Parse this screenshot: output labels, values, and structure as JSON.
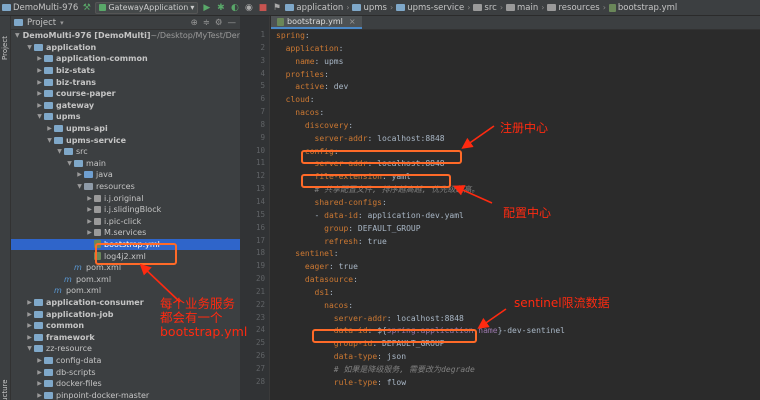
{
  "navbar": {
    "crumbs": [
      "DemoMulti-976",
      "application",
      "upms",
      "upms-service",
      "src",
      "main",
      "resources",
      "bootstrap.yml"
    ],
    "run_config": "GatewayApplication"
  },
  "side_tabs": {
    "project": "Project",
    "structure": "Structure"
  },
  "project_panel": {
    "title": "Project",
    "tree": [
      {
        "text": "DemoMulti-976 [DemoMulti]",
        "extra": " ~/Desktop/MyTest/Der",
        "indent": 0,
        "arrow": "down",
        "icon": "folder",
        "bold": true
      },
      {
        "text": "application",
        "indent": 1,
        "arrow": "down",
        "icon": "folder",
        "bold": true
      },
      {
        "text": "application-common",
        "indent": 2,
        "arrow": "right",
        "icon": "folder",
        "bold": true
      },
      {
        "text": "biz-stats",
        "indent": 2,
        "arrow": "right",
        "icon": "folder",
        "bold": true
      },
      {
        "text": "biz-trans",
        "indent": 2,
        "arrow": "right",
        "icon": "folder",
        "bold": true
      },
      {
        "text": "course-paper",
        "indent": 2,
        "arrow": "right",
        "icon": "folder",
        "bold": true
      },
      {
        "text": "gateway",
        "indent": 2,
        "arrow": "right",
        "icon": "folder",
        "bold": true
      },
      {
        "text": "upms",
        "indent": 2,
        "arrow": "down",
        "icon": "folder",
        "bold": true
      },
      {
        "text": "upms-api",
        "indent": 3,
        "arrow": "right",
        "icon": "folder",
        "bold": true
      },
      {
        "text": "upms-service",
        "indent": 3,
        "arrow": "down",
        "icon": "folder",
        "bold": true
      },
      {
        "text": "src",
        "indent": 4,
        "arrow": "down",
        "icon": "folder",
        "bold": false
      },
      {
        "text": "main",
        "indent": 5,
        "arrow": "down",
        "icon": "folder",
        "bold": false
      },
      {
        "text": "java",
        "indent": 6,
        "arrow": "right",
        "icon": "src",
        "bold": false
      },
      {
        "text": "resources",
        "indent": 6,
        "arrow": "down",
        "icon": "res",
        "bold": false
      },
      {
        "text": "i.j.original",
        "indent": 7,
        "arrow": "right",
        "icon": "pkg",
        "bold": false
      },
      {
        "text": "i.j.slidingBlock",
        "indent": 7,
        "arrow": "right",
        "icon": "pkg",
        "bold": false
      },
      {
        "text": "i.pic-click",
        "indent": 7,
        "arrow": "right",
        "icon": "pkg",
        "bold": false
      },
      {
        "text": "M.services",
        "indent": 7,
        "arrow": "right",
        "icon": "pkg",
        "bold": false
      },
      {
        "text": "bootstrap.yml",
        "indent": 7,
        "arrow": "none",
        "icon": "file",
        "bold": false,
        "selected": true
      },
      {
        "text": "log4j2.xml",
        "indent": 7,
        "arrow": "none",
        "icon": "file",
        "bold": false
      },
      {
        "text": "pom.xml",
        "indent": 5,
        "arrow": "none",
        "icon": "m",
        "bold": false
      },
      {
        "text": "pom.xml",
        "indent": 4,
        "arrow": "none",
        "icon": "m",
        "bold": false
      },
      {
        "text": "pom.xml",
        "indent": 3,
        "arrow": "none",
        "icon": "m",
        "bold": false
      },
      {
        "text": "application-consumer",
        "indent": 1,
        "arrow": "right",
        "icon": "folder",
        "bold": true
      },
      {
        "text": "application-job",
        "indent": 1,
        "arrow": "right",
        "icon": "folder",
        "bold": true
      },
      {
        "text": "common",
        "indent": 1,
        "arrow": "right",
        "icon": "folder",
        "bold": true
      },
      {
        "text": "framework",
        "indent": 1,
        "arrow": "right",
        "icon": "folder",
        "bold": true
      },
      {
        "text": "zz-resource",
        "indent": 1,
        "arrow": "down",
        "icon": "folder",
        "bold": false
      },
      {
        "text": "config-data",
        "indent": 2,
        "arrow": "right",
        "icon": "folder",
        "bold": false
      },
      {
        "text": "db-scripts",
        "indent": 2,
        "arrow": "right",
        "icon": "folder",
        "bold": false
      },
      {
        "text": "docker-files",
        "indent": 2,
        "arrow": "right",
        "icon": "folder",
        "bold": false
      },
      {
        "text": "pinpoint-docker-master",
        "indent": 2,
        "arrow": "right",
        "icon": "folder",
        "bold": false
      }
    ]
  },
  "editor": {
    "tab_label": "bootstrap.yml",
    "lines": [
      [
        {
          "t": "k",
          "s": "spring"
        },
        {
          "t": "v",
          "s": ":"
        }
      ],
      [
        {
          "t": "v",
          "s": "  "
        },
        {
          "t": "k",
          "s": "application"
        },
        {
          "t": "v",
          "s": ":"
        }
      ],
      [
        {
          "t": "v",
          "s": "    "
        },
        {
          "t": "k",
          "s": "name"
        },
        {
          "t": "v",
          "s": ": upms"
        }
      ],
      [
        {
          "t": "v",
          "s": "  "
        },
        {
          "t": "k",
          "s": "profiles"
        },
        {
          "t": "v",
          "s": ":"
        }
      ],
      [
        {
          "t": "v",
          "s": "    "
        },
        {
          "t": "k",
          "s": "active"
        },
        {
          "t": "v",
          "s": ": dev"
        }
      ],
      [
        {
          "t": "v",
          "s": "  "
        },
        {
          "t": "k",
          "s": "cloud"
        },
        {
          "t": "v",
          "s": ":"
        }
      ],
      [
        {
          "t": "v",
          "s": "    "
        },
        {
          "t": "k",
          "s": "nacos"
        },
        {
          "t": "v",
          "s": ":"
        }
      ],
      [
        {
          "t": "v",
          "s": "      "
        },
        {
          "t": "k",
          "s": "discovery"
        },
        {
          "t": "v",
          "s": ":"
        }
      ],
      [
        {
          "t": "v",
          "s": "        "
        },
        {
          "t": "k",
          "s": "server-addr"
        },
        {
          "t": "v",
          "s": ": localhost:8848"
        }
      ],
      [
        {
          "t": "v",
          "s": "      "
        },
        {
          "t": "k",
          "s": "config"
        },
        {
          "t": "v",
          "s": ":"
        }
      ],
      [
        {
          "t": "v",
          "s": "        "
        },
        {
          "t": "k",
          "s": "server-addr"
        },
        {
          "t": "v",
          "s": ": localhost:8848"
        }
      ],
      [
        {
          "t": "v",
          "s": "        "
        },
        {
          "t": "k",
          "s": "file-extension"
        },
        {
          "t": "v",
          "s": ": yaml"
        }
      ],
      [
        {
          "t": "v",
          "s": "        "
        },
        {
          "t": "c",
          "s": "# 共享配置文件, 排序越高越, 优先级越高。"
        }
      ],
      [
        {
          "t": "v",
          "s": "        "
        },
        {
          "t": "k",
          "s": "shared-configs"
        },
        {
          "t": "v",
          "s": ":"
        }
      ],
      [
        {
          "t": "v",
          "s": "        - "
        },
        {
          "t": "k",
          "s": "data-id"
        },
        {
          "t": "v",
          "s": ": application-dev.yaml"
        }
      ],
      [
        {
          "t": "v",
          "s": "          "
        },
        {
          "t": "k",
          "s": "group"
        },
        {
          "t": "v",
          "s": ": DEFAULT_GROUP"
        }
      ],
      [
        {
          "t": "v",
          "s": "          "
        },
        {
          "t": "k",
          "s": "refresh"
        },
        {
          "t": "v",
          "s": ": true"
        }
      ],
      [
        {
          "t": "v",
          "s": "    "
        },
        {
          "t": "k",
          "s": "sentinel"
        },
        {
          "t": "v",
          "s": ":"
        }
      ],
      [
        {
          "t": "v",
          "s": "      "
        },
        {
          "t": "k",
          "s": "eager"
        },
        {
          "t": "v",
          "s": ": true"
        }
      ],
      [
        {
          "t": "v",
          "s": "      "
        },
        {
          "t": "k",
          "s": "datasource"
        },
        {
          "t": "v",
          "s": ":"
        }
      ],
      [
        {
          "t": "v",
          "s": "        "
        },
        {
          "t": "k",
          "s": "ds1"
        },
        {
          "t": "v",
          "s": ":"
        }
      ],
      [
        {
          "t": "v",
          "s": "          "
        },
        {
          "t": "k",
          "s": "nacos"
        },
        {
          "t": "v",
          "s": ":"
        }
      ],
      [
        {
          "t": "v",
          "s": "            "
        },
        {
          "t": "k",
          "s": "server-addr"
        },
        {
          "t": "v",
          "s": ": localhost:8848"
        }
      ],
      [
        {
          "t": "v",
          "s": "            "
        },
        {
          "t": "k",
          "s": "data-id"
        },
        {
          "t": "v",
          "s": ": ${"
        },
        {
          "t": "t",
          "s": "spring.application.name"
        },
        {
          "t": "v",
          "s": "}-dev-sentinel"
        }
      ],
      [
        {
          "t": "v",
          "s": "            "
        },
        {
          "t": "k",
          "s": "group-id"
        },
        {
          "t": "v",
          "s": ": DEFAULT_GROUP"
        }
      ],
      [
        {
          "t": "v",
          "s": "            "
        },
        {
          "t": "k",
          "s": "data-type"
        },
        {
          "t": "v",
          "s": ": json"
        }
      ],
      [
        {
          "t": "v",
          "s": "            "
        },
        {
          "t": "c",
          "s": "# 如果是降级服务, 需要改为degrade"
        }
      ],
      [
        {
          "t": "v",
          "s": "            "
        },
        {
          "t": "k",
          "s": "rule-type"
        },
        {
          "t": "v",
          "s": ": flow"
        }
      ]
    ]
  },
  "annotations": {
    "registry": "注册中心",
    "config": "配置中心",
    "sentinel": "sentinel限流数据",
    "bootstrap": [
      "每个业务服务",
      "都会有一个",
      "bootstrap.yml"
    ]
  }
}
